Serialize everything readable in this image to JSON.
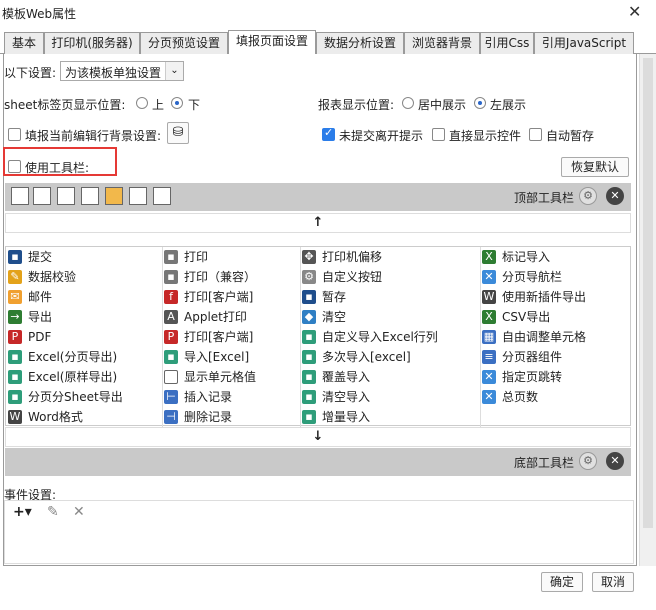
{
  "window": {
    "title": "模板Web属性",
    "close": "✕"
  },
  "tabs": [
    {
      "label": "基本"
    },
    {
      "label": "打印机(服务器)"
    },
    {
      "label": "分页预览设置"
    },
    {
      "label": "填报页面设置"
    },
    {
      "label": "数据分析设置"
    },
    {
      "label": "浏览器背景"
    },
    {
      "label": "引用Css"
    },
    {
      "label": "引用JavaScript"
    }
  ],
  "settings": {
    "scope_label": "以下设置:",
    "scope_value": "为该模板单独设置",
    "sheet_label": "sheet标签页显示位置:",
    "sheet_top": "上",
    "sheet_bottom": "下",
    "report_label": "报表显示位置:",
    "report_center": "居中展示",
    "report_left": "左展示",
    "bg_label": "填报当前编辑行背景设置:",
    "unsubmitted_label": "未提交离开提示",
    "direct_label": "直接显示控件",
    "autosave_label": "自动暂存",
    "toolbar_label": "使用工具栏:",
    "restore_label": "恢复默认"
  },
  "top_toolbar": {
    "label": "顶部工具栏"
  },
  "bottom_toolbar": {
    "label": "底部工具栏"
  },
  "arrows": {
    "up": "↑",
    "down": "↓"
  },
  "buttons": [
    [
      "提交",
      "打印",
      "打印机偏移",
      "标记导入"
    ],
    [
      "数据校验",
      "打印（兼容）",
      "自定义按钮",
      "分页导航栏"
    ],
    [
      "邮件",
      "打印[客户端]",
      "暂存",
      "使用新插件导出"
    ],
    [
      "导出",
      "Applet打印",
      "清空",
      "CSV导出"
    ],
    [
      "PDF",
      "打印[客户端]",
      "自定义导入Excel行列",
      "自由调整单元格"
    ],
    [
      "Excel(分页导出)",
      "导入[Excel]",
      "多次导入[excel]",
      "分页器组件"
    ],
    [
      "Excel(原样导出)",
      "显示单元格值",
      "覆盖导入",
      "指定页跳转"
    ],
    [
      "分页分Sheet导出",
      "插入记录",
      "清空导入",
      "总页数"
    ],
    [
      "Word格式",
      "删除记录",
      "增量导入",
      ""
    ]
  ],
  "events": {
    "label": "事件设置:",
    "add": "+▾",
    "edit": "✎",
    "delete": "✕"
  },
  "footer": {
    "ok": "确定",
    "cancel": "取消"
  }
}
